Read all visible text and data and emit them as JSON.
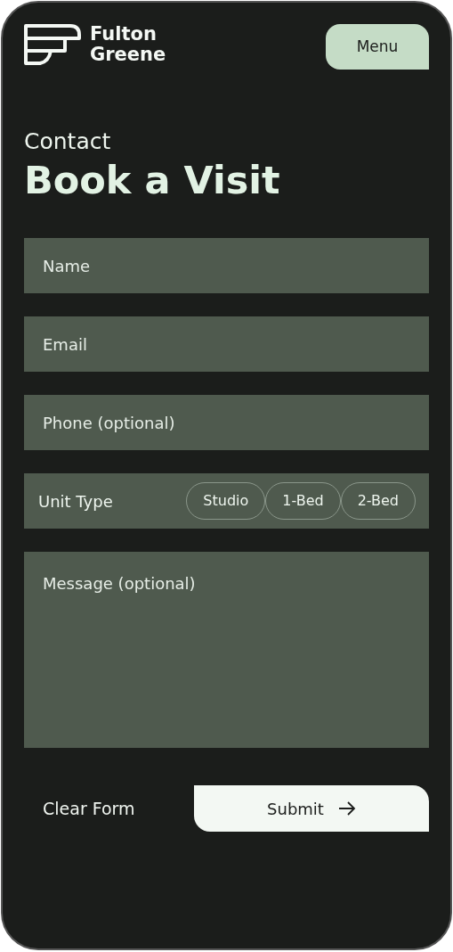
{
  "brand": {
    "line_1": "Fulton",
    "line_2": "Greene"
  },
  "menu_button": "Menu",
  "eyebrow": "Contact",
  "title": "Book a Visit",
  "fields": [
    {
      "kind": "input",
      "placeholder": "Name"
    },
    {
      "kind": "input",
      "placeholder": "Email"
    },
    {
      "kind": "input",
      "placeholder": "Phone (optional)"
    },
    {
      "kind": "choice",
      "label": "Unit Type",
      "options": [
        {
          "label": "Studio",
          "selected": false
        },
        {
          "label": "1-Bed",
          "selected": false
        },
        {
          "label": "2-Bed",
          "selected": false
        }
      ]
    },
    {
      "kind": "textarea",
      "placeholder": "Message (optional)"
    }
  ],
  "clear_button": "Clear Form",
  "submit_button": "Submit"
}
